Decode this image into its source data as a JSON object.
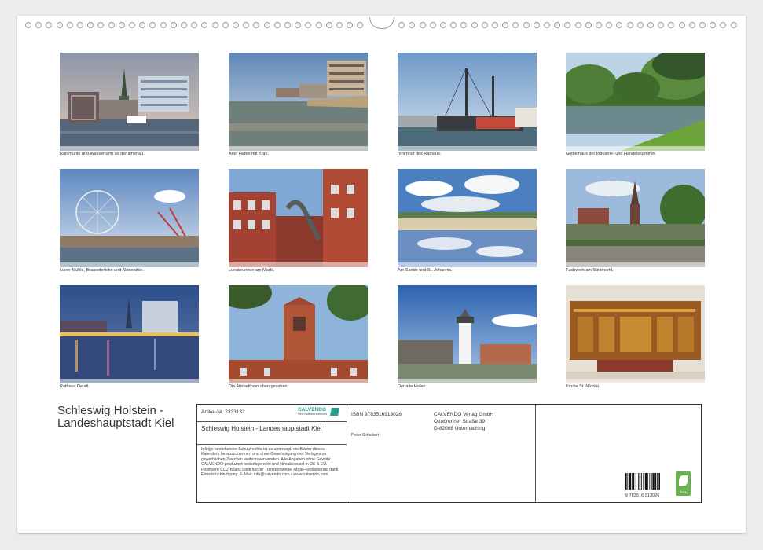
{
  "photos": [
    {
      "caption": "Ratsmühle und Wasserturm an der Ilmenau."
    },
    {
      "caption": "Alter Hafen mit Kran."
    },
    {
      "caption": "Innenhof des Rathaus."
    },
    {
      "caption": "Giebelhaus der Industrie- und Handelskammer."
    },
    {
      "caption": "Lüner Mühle, Brausebrücke und Abtsmühle."
    },
    {
      "caption": "Lunabrunnen am Markt."
    },
    {
      "caption": "Am Sande und St. Johannis."
    },
    {
      "caption": "Fachwerk am Stintmarkt."
    },
    {
      "caption": "Rathaus Detail."
    },
    {
      "caption": "Die Altstadt von oben gesehen."
    },
    {
      "caption": "Der alte Hafen."
    },
    {
      "caption": "Kirche St. Nicolai."
    }
  ],
  "title": "Schleswig Holstein - Landeshauptstadt Kiel",
  "article_label": "Artikel-Nr. 2333132",
  "brand_name": "CALVENDO",
  "brand_tagline": "Mein Kalendersortiment",
  "subtitle": "Schleswig Holstein - Landeshauptstadt Kiel",
  "legal_text": "Infolge bestehender Schutzrechte ist es untersagt, die Blätter dieses Kalenders herauszutrennen und ohne Genehmigung des Verlages zu gewerblichen Zwecken weiterzuverwenden. Alle Angaben ohne Gewähr. CALVENDO produziert bedarfsgerecht und klimabewusst in DE & EU. Positivere CO2-Bilanz dank kurzer Transportwege. Abfall-Reduzierung dank Einzelstückfertigung. E-Mail: info@calvendo.com • www.calvendo.com",
  "isbn": "ISBN 9783516913026",
  "author": "Peter Schickert",
  "publisher_lines": [
    "CALVENDO Verlag GmbH",
    "Ottobrunner Straße 39",
    "D-82008 Unterhaching"
  ],
  "barcode_number": "9 783516 913026",
  "eco_label": "feca",
  "colors": {
    "brand_teal": "#2a9d8f",
    "eco_green": "#6ab04c"
  }
}
